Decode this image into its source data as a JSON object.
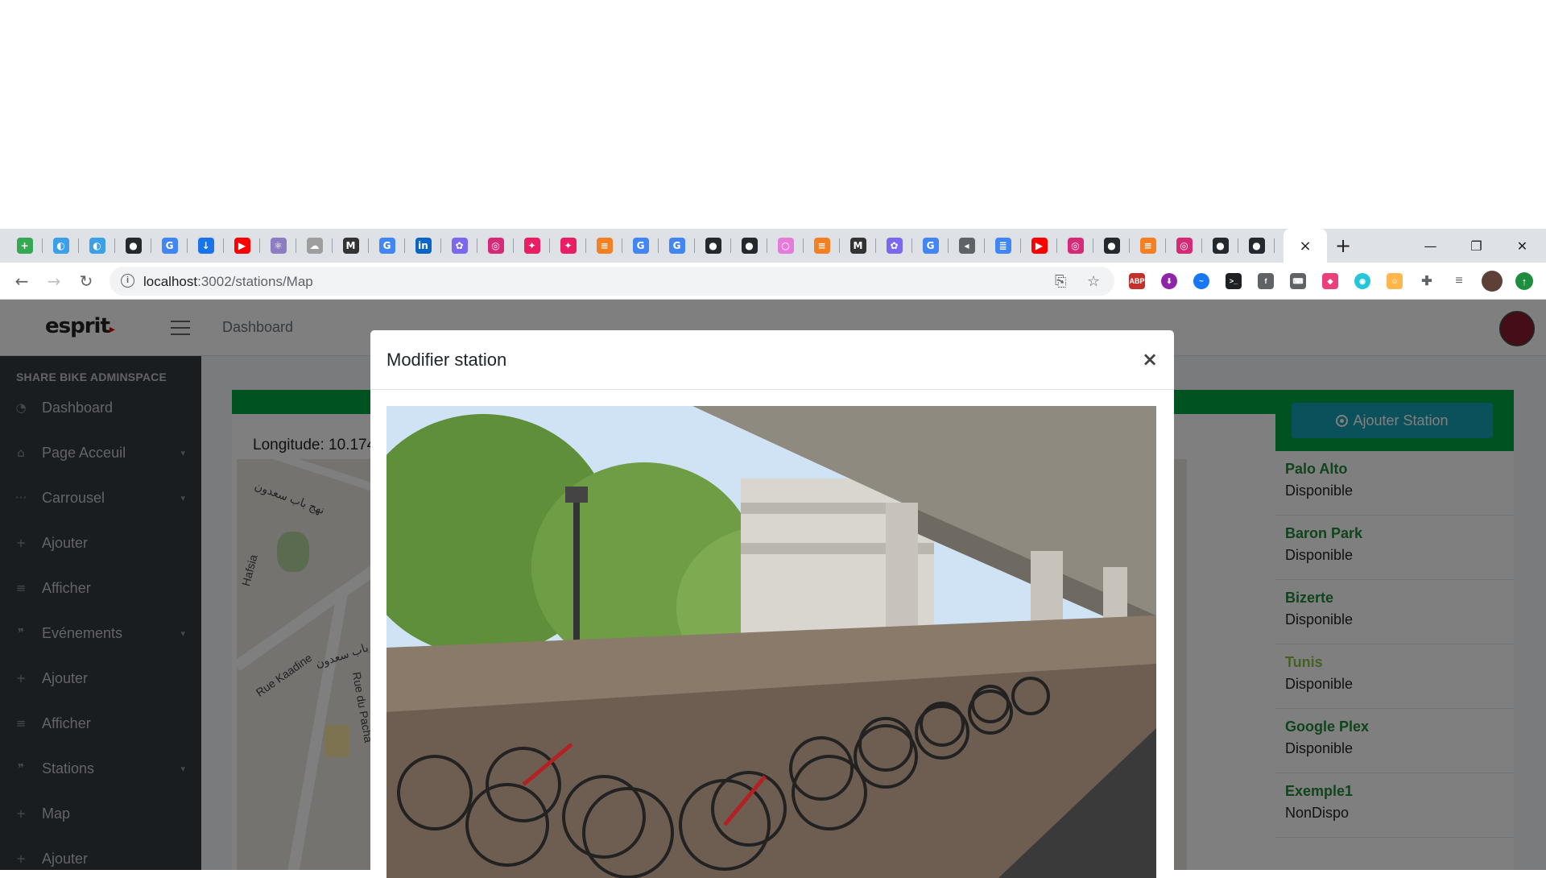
{
  "browser": {
    "tabs": [
      {
        "icon": "sheets-icon",
        "color": "#34a853",
        "glyph": "+"
      },
      {
        "icon": "edge-icon",
        "color": "#3aa0e8",
        "glyph": "◐"
      },
      {
        "icon": "edge-icon",
        "color": "#3aa0e8",
        "glyph": "◐"
      },
      {
        "icon": "github-icon",
        "color": "#24292e",
        "glyph": "●"
      },
      {
        "icon": "google-icon",
        "color": "#4285f4",
        "glyph": "G"
      },
      {
        "icon": "download-icon",
        "color": "#1a73e8",
        "glyph": "↓"
      },
      {
        "icon": "youtube-icon",
        "color": "#ff0000",
        "glyph": "▶"
      },
      {
        "icon": "hash-icon",
        "color": "#8e7cc3",
        "glyph": "⚛"
      },
      {
        "icon": "cloud-icon",
        "color": "#9e9e9e",
        "glyph": "☁"
      },
      {
        "icon": "medium-icon",
        "color": "#333333",
        "glyph": "M"
      },
      {
        "icon": "google-icon",
        "color": "#4285f4",
        "glyph": "G"
      },
      {
        "icon": "linkedin-icon",
        "color": "#0a66c2",
        "glyph": "in"
      },
      {
        "icon": "openai-icon",
        "color": "#7b68ee",
        "glyph": "✿"
      },
      {
        "icon": "instagram-icon",
        "color": "#d62976",
        "glyph": "◎"
      },
      {
        "icon": "postman-icon",
        "color": "#e91e63",
        "glyph": "✦"
      },
      {
        "icon": "postman-icon",
        "color": "#e91e63",
        "glyph": "✦"
      },
      {
        "icon": "stackoverflow-icon",
        "color": "#f48024",
        "glyph": "≡"
      },
      {
        "icon": "google-icon",
        "color": "#4285f4",
        "glyph": "G"
      },
      {
        "icon": "google-icon",
        "color": "#4285f4",
        "glyph": "G"
      },
      {
        "icon": "github-icon",
        "color": "#24292e",
        "glyph": "●"
      },
      {
        "icon": "github-icon",
        "color": "#24292e",
        "glyph": "●"
      },
      {
        "icon": "toggl-icon",
        "color": "#e57cd8",
        "glyph": "○"
      },
      {
        "icon": "stackoverflow-icon",
        "color": "#f48024",
        "glyph": "≡"
      },
      {
        "icon": "medium-icon",
        "color": "#333333",
        "glyph": "M"
      },
      {
        "icon": "openai-icon",
        "color": "#7b68ee",
        "glyph": "✿"
      },
      {
        "icon": "google-icon",
        "color": "#4285f4",
        "glyph": "G"
      },
      {
        "icon": "audio-icon",
        "color": "#5f6368",
        "glyph": "◂"
      },
      {
        "icon": "docs-icon",
        "color": "#4285f4",
        "glyph": "≣"
      },
      {
        "icon": "youtube-icon",
        "color": "#ff0000",
        "glyph": "▶"
      },
      {
        "icon": "instagram-icon",
        "color": "#d62976",
        "glyph": "◎"
      },
      {
        "icon": "github-icon",
        "color": "#24292e",
        "glyph": "●"
      },
      {
        "icon": "stackoverflow-icon",
        "color": "#f48024",
        "glyph": "≡"
      },
      {
        "icon": "instagram-icon",
        "color": "#d62976",
        "glyph": "◎"
      },
      {
        "icon": "github-icon",
        "color": "#24292e",
        "glyph": "●"
      },
      {
        "icon": "github-icon",
        "color": "#24292e",
        "glyph": "●"
      }
    ],
    "active_tab_close": "×",
    "new_tab": "+",
    "window_controls": {
      "minimize": "—",
      "maximize": "❐",
      "close": "✕"
    },
    "nav": {
      "back": "←",
      "forward": "→",
      "reload": "↻"
    },
    "url_host": "localhost",
    "url_path": ":3002/stations/Map"
  },
  "app": {
    "logo": "esprit",
    "header_link": "Dashboard",
    "sidebar_brand": "SHARE BIKE ADMINSPACE",
    "sidebar": [
      {
        "label": "Dashboard",
        "icon": "dashboard-icon",
        "glyph": "◔",
        "chevron": false
      },
      {
        "label": "Page Acceuil",
        "icon": "home-icon",
        "glyph": "⌂",
        "chevron": true
      },
      {
        "label": "Carrousel",
        "icon": "dots-icon",
        "glyph": "···",
        "chevron": true
      },
      {
        "label": "Ajouter",
        "icon": "plus-icon",
        "glyph": "+",
        "chevron": false
      },
      {
        "label": "Afficher",
        "icon": "list-icon",
        "glyph": "≡",
        "chevron": false
      },
      {
        "label": "Evénements",
        "icon": "quote-icon",
        "glyph": "❞",
        "chevron": true
      },
      {
        "label": "Ajouter",
        "icon": "plus-icon",
        "glyph": "+",
        "chevron": false
      },
      {
        "label": "Afficher",
        "icon": "list-icon",
        "glyph": "≡",
        "chevron": false
      },
      {
        "label": "Stations",
        "icon": "quote-icon",
        "glyph": "❞",
        "chevron": true
      },
      {
        "label": "Map",
        "icon": "plus-icon",
        "glyph": "+",
        "chevron": false
      },
      {
        "label": "Ajouter",
        "icon": "plus-icon",
        "glyph": "+",
        "chevron": false
      }
    ],
    "longitude_label": "Longitude: 10.174",
    "map_streets": [
      "نهج باب سعدون",
      "Rue Kaadine",
      "نهج باب سعدون",
      "Rue du Pacha",
      "Hafsia"
    ],
    "add_station_label": "Ajouter Station",
    "stations": [
      {
        "name": "Palo Alto",
        "status": "Disponible"
      },
      {
        "name": "Baron Park",
        "status": "Disponible"
      },
      {
        "name": "Bizerte",
        "status": "Disponible"
      },
      {
        "name": "Tunis",
        "status": "Disponible"
      },
      {
        "name": "Google Plex",
        "status": "Disponible"
      },
      {
        "name": "Exemple1",
        "status": "NonDispo"
      }
    ],
    "selected_station_index": 3
  },
  "modal": {
    "title": "Modifier station",
    "close": "×",
    "photo": "bike-parking-photo"
  },
  "colors": {
    "accent_green": "#00a441",
    "button_teal": "#17a2b8",
    "station_name": "#218838",
    "sidebar_bg": "#343a40"
  }
}
